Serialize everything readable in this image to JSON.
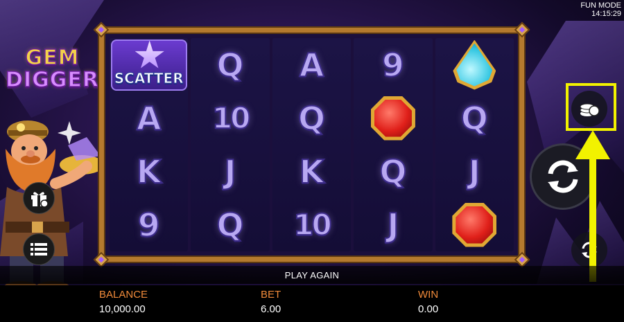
{
  "top_info": {
    "mode": "FUN MODE",
    "time": "14:15:29"
  },
  "logo": {
    "line1": "GEM",
    "line2": "DIGGER"
  },
  "reels": [
    [
      {
        "type": "scatter",
        "label": "SCATTER"
      },
      {
        "type": "text",
        "label": "A"
      },
      {
        "type": "text",
        "label": "K"
      },
      {
        "type": "text",
        "label": "9"
      }
    ],
    [
      {
        "type": "text",
        "label": "Q"
      },
      {
        "type": "text",
        "label": "10"
      },
      {
        "type": "text",
        "label": "J"
      },
      {
        "type": "text",
        "label": "Q"
      }
    ],
    [
      {
        "type": "text",
        "label": "A"
      },
      {
        "type": "text",
        "label": "Q"
      },
      {
        "type": "text",
        "label": "K"
      },
      {
        "type": "text",
        "label": "10"
      }
    ],
    [
      {
        "type": "text",
        "label": "9"
      },
      {
        "type": "icon",
        "label": "red-gem"
      },
      {
        "type": "text",
        "label": "Q"
      },
      {
        "type": "text",
        "label": "J"
      }
    ],
    [
      {
        "type": "icon",
        "label": "blue-gem"
      },
      {
        "type": "text",
        "label": "Q"
      },
      {
        "type": "text",
        "label": "J"
      },
      {
        "type": "icon",
        "label": "red-gem"
      }
    ]
  ],
  "buttons": {
    "gift_icon": "gift-icon",
    "menu_icon": "menu-list-icon",
    "coins_icon": "coins-stack-icon",
    "spin_icon": "spin-icon",
    "autoplay_icon": "autoplay-icon"
  },
  "play_again": "PLAY AGAIN",
  "footer": {
    "balance_label": "BALANCE",
    "balance_value": "10,000.00",
    "bet_label": "BET",
    "bet_value": "6.00",
    "win_label": "WIN",
    "win_value": "0.00"
  },
  "colors": {
    "frame_gold": "#b57a2e",
    "label_orange": "#f08a3a",
    "highlight_yellow": "#f2f200",
    "symbol_lilac": "#b8a8f2"
  }
}
